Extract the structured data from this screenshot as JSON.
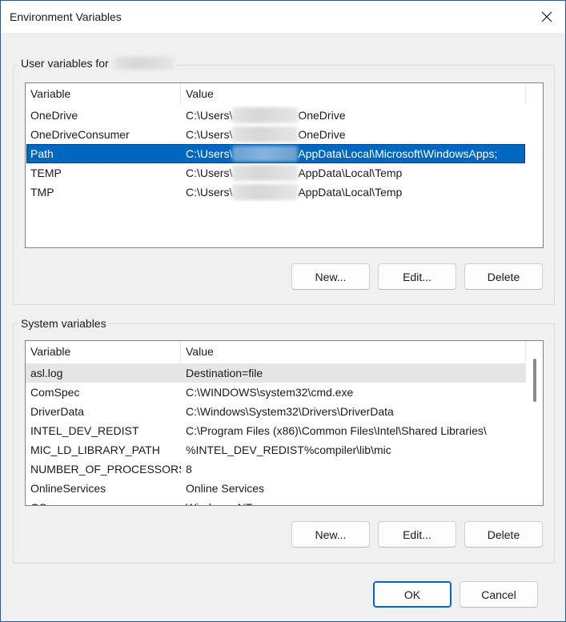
{
  "window": {
    "title": "Environment Variables"
  },
  "user_group": {
    "label": "User variables for",
    "columns": [
      "Variable",
      "Value"
    ],
    "rows": [
      {
        "name": "OneDrive",
        "value_prefix": "C:\\Users\\",
        "value_suffix": "OneDrive"
      },
      {
        "name": "OneDriveConsumer",
        "value_prefix": "C:\\Users\\",
        "value_suffix": "OneDrive"
      },
      {
        "name": "Path",
        "value_prefix": "C:\\Users\\",
        "value_suffix": "AppData\\Local\\Microsoft\\WindowsApps;"
      },
      {
        "name": "TEMP",
        "value_prefix": "C:\\Users\\",
        "value_suffix": "AppData\\Local\\Temp"
      },
      {
        "name": "TMP",
        "value_prefix": "C:\\Users\\",
        "value_suffix": "AppData\\Local\\Temp"
      }
    ],
    "buttons": {
      "new": "New...",
      "edit": "Edit...",
      "delete": "Delete"
    }
  },
  "system_group": {
    "label": "System variables",
    "columns": [
      "Variable",
      "Value"
    ],
    "rows": [
      {
        "name": "asl.log",
        "value": "Destination=file"
      },
      {
        "name": "ComSpec",
        "value": "C:\\WINDOWS\\system32\\cmd.exe"
      },
      {
        "name": "DriverData",
        "value": "C:\\Windows\\System32\\Drivers\\DriverData"
      },
      {
        "name": "INTEL_DEV_REDIST",
        "value": "C:\\Program Files (x86)\\Common Files\\Intel\\Shared Libraries\\"
      },
      {
        "name": "MIC_LD_LIBRARY_PATH",
        "value": "%INTEL_DEV_REDIST%compiler\\lib\\mic"
      },
      {
        "name": "NUMBER_OF_PROCESSORS",
        "value": "8"
      },
      {
        "name": "OnlineServices",
        "value": "Online Services"
      },
      {
        "name": "OS",
        "value": "Windows_NT"
      }
    ],
    "buttons": {
      "new": "New...",
      "edit": "Edit...",
      "delete": "Delete"
    }
  },
  "footer": {
    "ok": "OK",
    "cancel": "Cancel"
  },
  "colors": {
    "accent": "#0067c0",
    "border": "#2b5797"
  }
}
